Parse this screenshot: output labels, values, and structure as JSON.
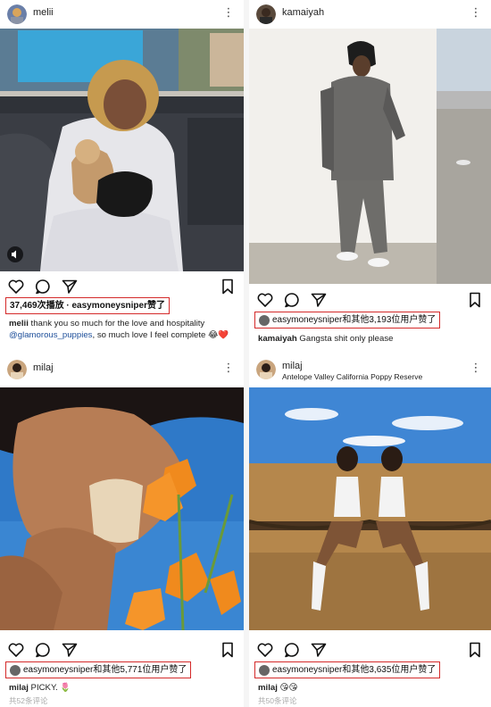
{
  "posts": [
    {
      "username": "melii",
      "likes_text": "37,469次播放 · easymoneysniper赞了",
      "caption_user": "melii",
      "caption_text": "thank you so much for the love and hospitality",
      "caption_tag": "@glamorous_puppies",
      "caption_text2": ", so much love I feel complete",
      "caption_emoji": "😂❤️"
    },
    {
      "username": "kamaiyah",
      "likes_text": "easymoneysniper和其他3,193位用户赞了",
      "caption_user": "kamaiyah",
      "caption_text": "Gangsta shit only please"
    },
    {
      "username": "milaj",
      "likes_text": "easymoneysniper和其他5,771位用户赞了",
      "caption_user": "milaj",
      "caption_text": "PICKY. 🌷",
      "comments": "共52条评论"
    },
    {
      "username": "milaj",
      "location": "Antelope Valley California Poppy Reserve",
      "likes_text": "easymoneysniper和其他3,635位用户赞了",
      "caption_user": "milaj",
      "caption_text": "😘😘",
      "comments": "共50条评论"
    }
  ],
  "icons": [
    "heart-icon",
    "comment-icon",
    "share-icon",
    "bookmark-icon",
    "mute-icon",
    "more-icon"
  ],
  "more_glyph": "⋮",
  "colors": {
    "highlight_border": "#d42a2a",
    "tag_link": "#1e4f9a"
  }
}
